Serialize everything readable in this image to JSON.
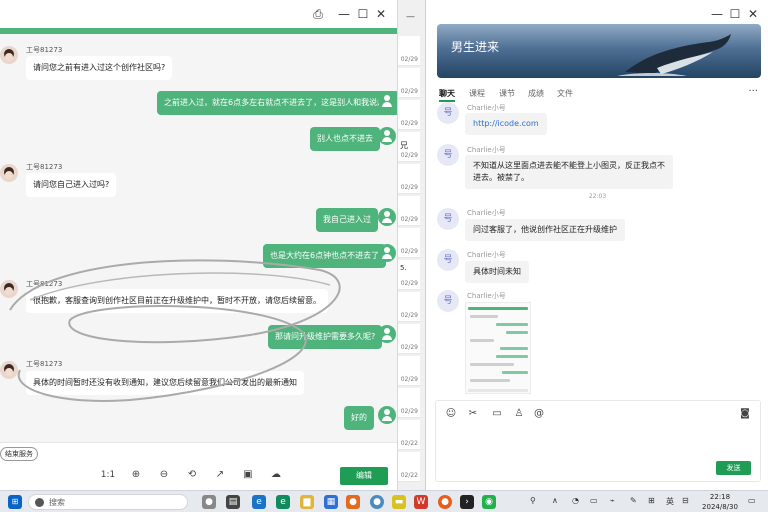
{
  "left_window": {
    "controls": {
      "print": "⎙",
      "minimize": "—",
      "maximize": "☐",
      "close": "✕"
    },
    "messages": [
      {
        "side": "left",
        "sender": "工号81273",
        "text": "请问您之前有进入过这个创作社区吗?"
      },
      {
        "side": "right",
        "text": "之前进入过，就在6点多左右就点不进去了，这是别人和我说的。"
      },
      {
        "side": "right",
        "text": "别人也点不进去"
      },
      {
        "side": "left",
        "sender": "工号81273",
        "text": "请问您自己进入过吗?"
      },
      {
        "side": "right",
        "text": "我自己进入过"
      },
      {
        "side": "right",
        "text": "也是大约在6点钟也点不进去了"
      },
      {
        "side": "left",
        "sender": "工号81273",
        "text": "很抱歉，客服查询到创作社区目前正在升级维护中，暂时不开放，请您后续留意。"
      },
      {
        "side": "right",
        "text": "那请问升级维护需要多久呢?"
      },
      {
        "side": "left",
        "sender": "工号81273",
        "text": "具体的时间暂时还没有收到通知，建议您后续留意我们公司发出的最新通知"
      },
      {
        "side": "right",
        "text": "好的"
      }
    ],
    "end_service_label": "结束服务",
    "toolbar": {
      "ratio": "1:1",
      "edit_label": "编辑"
    }
  },
  "strip": {
    "dates": [
      "02/29",
      "02/29",
      "02/29",
      "02/29",
      "02/29",
      "02/29",
      "02/29",
      "02/29",
      "02/29",
      "02/29",
      "02/29",
      "02/29",
      "02/22",
      "02/22"
    ],
    "fragments": [
      "兄",
      "5."
    ]
  },
  "right_window": {
    "controls": {
      "minimize": "—",
      "maximize": "☐",
      "close": "✕"
    },
    "banner_title": "男生进来",
    "tabs": [
      "聊天",
      "课程",
      "课节",
      "成绩",
      "文件"
    ],
    "more": "···",
    "avatar_char": "号",
    "messages": [
      {
        "sender": "Charlie小号",
        "text": "http://icode.com",
        "kind": "link"
      },
      {
        "sender": "Charlie小号",
        "text": "不知道从这里面点进去能不能登上小图灵，反正我点不进去。被禁了。",
        "line1": "不知道从这里面点进去能不能登上小图灵，反正我点不",
        "line2": "进去。被禁了。"
      },
      {
        "sender": "Charlie小号",
        "text": "问过客服了，他说创作社区正在升级维护"
      },
      {
        "sender": "Charlie小号",
        "text": "具体时间未知"
      },
      {
        "sender": "Charlie小号",
        "kind": "image"
      }
    ],
    "timestamp": "22:03",
    "send_label": "发送"
  },
  "taskbar": {
    "search_placeholder": "搜索",
    "ime_label": "英",
    "time": "22:18",
    "date": "2024/8/30"
  }
}
